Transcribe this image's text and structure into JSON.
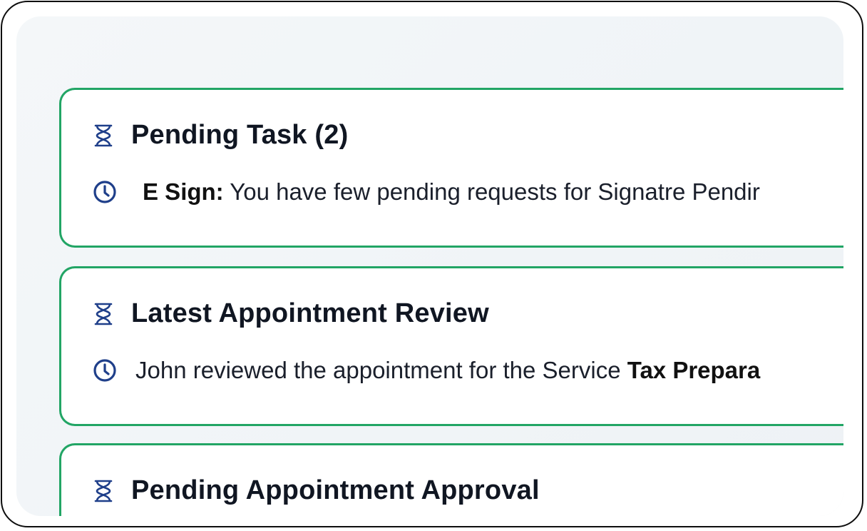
{
  "cards": [
    {
      "title": "Pending Task (2)",
      "icon": "hourglass-icon",
      "row": {
        "icon": "clock-icon",
        "bold_prefix": "E Sign:",
        "text": " You have few pending requests for Signatre Pendir"
      }
    },
    {
      "title": "Latest Appointment Review",
      "icon": "hourglass-icon",
      "row": {
        "icon": "clock-icon",
        "text": "John reviewed the appointment for the Service ",
        "bold_suffix": "Tax Prepara"
      }
    },
    {
      "title": "Pending Appointment Approval",
      "icon": "hourglass-icon"
    }
  ],
  "colors": {
    "accent_border": "#22a565",
    "icon_blue": "#1f3f8a",
    "title_text": "#101622",
    "background_panel": "#f2f5f8"
  }
}
